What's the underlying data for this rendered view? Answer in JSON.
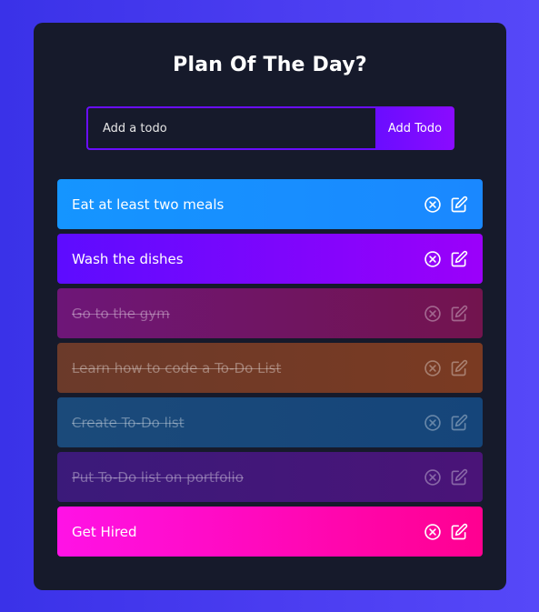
{
  "app": {
    "title": "Plan Of The Day?"
  },
  "form": {
    "placeholder": "Add a todo",
    "value": "",
    "button_label": "Add Todo"
  },
  "todos": [
    {
      "text": "Eat at least two meals",
      "completed": false,
      "color": "#1595ff"
    },
    {
      "text": "Wash the dishes",
      "completed": false,
      "color": "#8a05fc"
    },
    {
      "text": "Go to the gym",
      "completed": true,
      "color": "#70154f"
    },
    {
      "text": "Learn how to code a To-Do List",
      "completed": true,
      "color": "#733a26"
    },
    {
      "text": "Create To-Do list",
      "completed": true,
      "color": "#18477a"
    },
    {
      "text": "Put To-Do list on portfolio",
      "completed": true,
      "color": "#431779"
    },
    {
      "text": "Get Hired",
      "completed": false,
      "color": "#ff0cc0"
    }
  ],
  "icons": {
    "delete": "close-circle-icon",
    "edit": "edit-icon"
  }
}
